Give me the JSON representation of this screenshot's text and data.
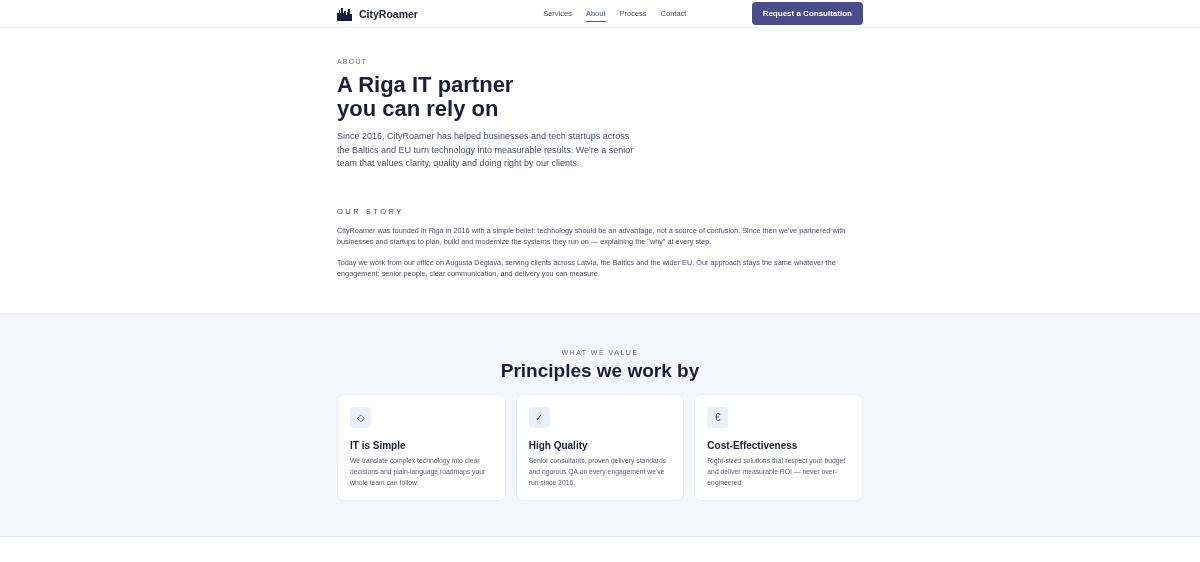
{
  "header": {
    "brand": "CityRoamer",
    "nav": [
      {
        "label": "Services",
        "selected": false
      },
      {
        "label": "About",
        "selected": true
      },
      {
        "label": "Process",
        "selected": false
      },
      {
        "label": "Contact",
        "selected": false
      }
    ],
    "cta": "Request a Consultation"
  },
  "hero": {
    "eyebrow": "ABOUT",
    "title_lines": [
      "A Riga IT partner",
      "you can rely on"
    ],
    "lead": "Since 2016, CityRoamer has helped businesses and tech startups across the Baltics and EU turn technology into measurable results. We're a senior team that values clarity, quality and doing right by our clients."
  },
  "story": {
    "heading": "OUR STORY",
    "paragraphs": [
      "CityRoamer was founded in Riga in 2016 with a simple belief: technology should be an advantage, not a source of confusion. Since then we've partnered with businesses and startups to plan, build and modernize the systems they run on — explaining the \"why\" at every step.",
      "Today we work from our office on Augusta Deglava, serving clients across Latvia, the Baltics and the wider EU. Our approach stays the same whatever the engagement: senior people, clear communication, and delivery you can measure."
    ]
  },
  "values": {
    "eyebrow": "WHAT WE VALUE",
    "title": "Principles we work by",
    "cards": [
      {
        "icon": "◇",
        "title": "IT is Simple",
        "text": "We translate complex technology into clear decisions and plain-language roadmaps your whole team can follow."
      },
      {
        "icon": "✓",
        "title": "High Quality",
        "text": "Senior consultants, proven delivery standards and rigorous QA on every engagement we've run since 2016."
      },
      {
        "icon": "€",
        "title": "Cost-Effectiveness",
        "text": "Right-sized solutions that respect your budget and deliver measurable ROI — never over-engineered."
      }
    ]
  }
}
